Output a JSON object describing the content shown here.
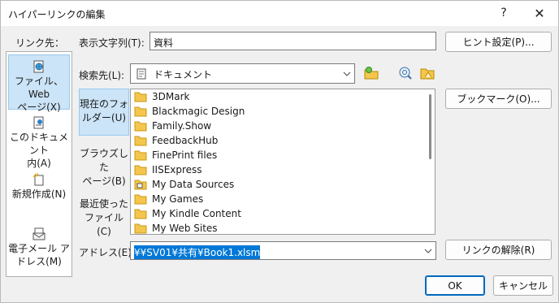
{
  "window": {
    "title": "ハイパーリンクの編集",
    "help_glyph": "?",
    "close_glyph": "✕"
  },
  "linkto": {
    "label": "リンク先：",
    "items": [
      {
        "line1": "ファイル、Web",
        "line2": "ページ(X)",
        "icon": "globe-document-icon",
        "selected": true
      },
      {
        "line1": "このドキュメント",
        "line2": "内(A)",
        "icon": "document-place-icon",
        "selected": false
      },
      {
        "line1": "新規作成(N)",
        "line2": "",
        "icon": "new-document-icon",
        "selected": false
      },
      {
        "line1": "電子メール ア",
        "line2": "ドレス(M)",
        "icon": "email-icon",
        "selected": false
      }
    ]
  },
  "display_text": {
    "label": "表示文字列(T):",
    "value": "資料"
  },
  "screentip_button": "ヒント設定(P)...",
  "look_in": {
    "label": "検索先(L):",
    "value": "ドキュメント",
    "icon": "folder-documents-icon"
  },
  "toolbar_icons": [
    "browse-web-icon",
    "browse-file-icon",
    "up-folder-icon"
  ],
  "side_tabs": [
    {
      "line1": "現在のフォ",
      "line2": "ルダー(U)",
      "selected": true
    },
    {
      "line1": "ブラウズした",
      "line2": "ページ(B)",
      "selected": false
    },
    {
      "line1": "最近使った",
      "line2": "ファイル(C)",
      "selected": false
    }
  ],
  "files": [
    {
      "name": "3DMark",
      "icon": "folder-icon"
    },
    {
      "name": "Blackmagic Design",
      "icon": "folder-icon"
    },
    {
      "name": "Family.Show",
      "icon": "folder-icon"
    },
    {
      "name": "FeedbackHub",
      "icon": "folder-icon"
    },
    {
      "name": "FinePrint files",
      "icon": "folder-icon"
    },
    {
      "name": "IISExpress",
      "icon": "folder-icon"
    },
    {
      "name": "My Data Sources",
      "icon": "data-sources-folder-icon"
    },
    {
      "name": "My Games",
      "icon": "folder-icon"
    },
    {
      "name": "My Kindle Content",
      "icon": "folder-icon"
    },
    {
      "name": "My Web Sites",
      "icon": "folder-icon"
    }
  ],
  "bookmark_button": "ブックマーク(O)...",
  "address": {
    "label": "アドレス(E):",
    "value": "¥¥SV01¥共有¥Book1.xlsm"
  },
  "remove_link_button": "リンクの解除(R)",
  "ok_button": "OK",
  "cancel_button": "キャンセル",
  "colors": {
    "selection": "#cce4f7",
    "accent": "#0078d7",
    "folder": "#f4c64d"
  }
}
